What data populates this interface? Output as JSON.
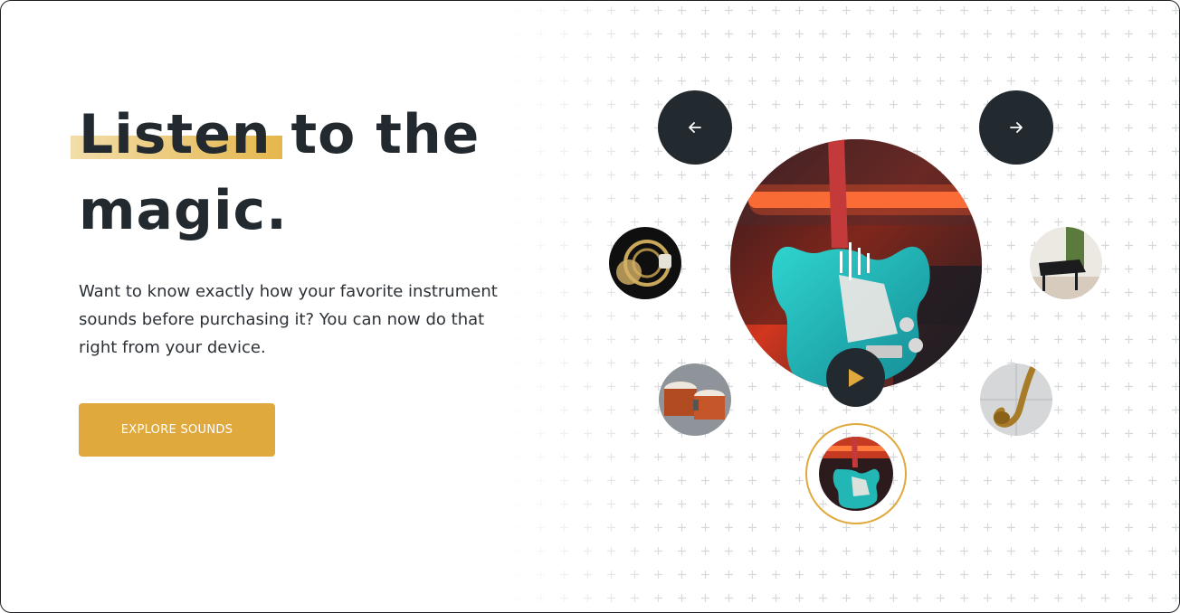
{
  "hero": {
    "title_highlight": "Listen",
    "title_rest_line1": " to the",
    "title_line2": "magic.",
    "description": "Want to know exactly how your favorite instrument sounds before purchasing it? You can now do that right from your device.",
    "cta_label": "EXPLORE SOUNDS"
  },
  "carousel": {
    "prev_icon": "arrow-left-icon",
    "next_icon": "arrow-right-icon",
    "featured": "electric guitar",
    "play_icon": "play-icon",
    "waveform_icon": "sound-wave-icon",
    "thumbnails": [
      "french horn",
      "grand piano",
      "bongo drums",
      "saxophone",
      "electric guitar"
    ],
    "active_thumbnail": "electric guitar"
  },
  "colors": {
    "accent": "#e0a93d",
    "dark": "#222a30",
    "text": "#2c3136"
  }
}
